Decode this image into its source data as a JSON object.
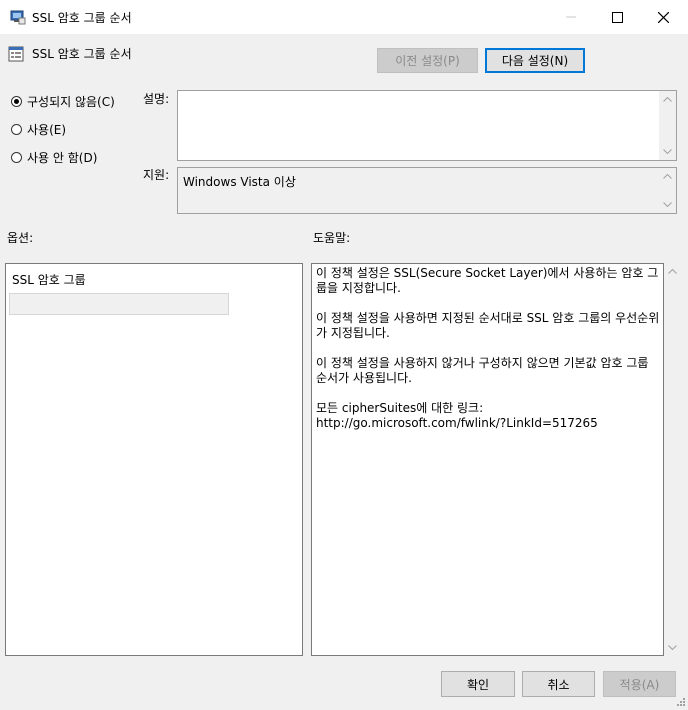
{
  "window": {
    "title": "SSL 암호 그룹 순서"
  },
  "header": {
    "title": "SSL 암호 그룹 순서",
    "prev_label": "이전 설정(P)",
    "next_label": "다음 설정(N)"
  },
  "state": {
    "options": [
      {
        "label": "구성되지 않음(C)",
        "checked": true
      },
      {
        "label": "사용(E)",
        "checked": false
      },
      {
        "label": "사용 안 함(D)",
        "checked": false
      }
    ]
  },
  "comment": {
    "label": "설명:",
    "value": ""
  },
  "supported": {
    "label": "지원:",
    "value": "Windows Vista 이상"
  },
  "options_section": {
    "label": "옵션:",
    "field_label": "SSL 암호 그룹",
    "field_value": ""
  },
  "help_section": {
    "label": "도움말:",
    "paragraphs": [
      "이 정책 설정은 SSL(Secure Socket Layer)에서 사용하는 암호 그룹을 지정합니다.",
      "이 정책 설정을 사용하면 지정된 순서대로 SSL 암호 그룹의 우선순위가 지정됩니다.",
      "이 정책 설정을 사용하지 않거나 구성하지 않으면 기본값 암호 그룹 순서가 사용됩니다.",
      "모든 cipherSuites에 대한 링크:\nhttp://go.microsoft.com/fwlink/?LinkId=517265"
    ]
  },
  "footer": {
    "ok_label": "확인",
    "cancel_label": "취소",
    "apply_label": "적용(A)"
  }
}
